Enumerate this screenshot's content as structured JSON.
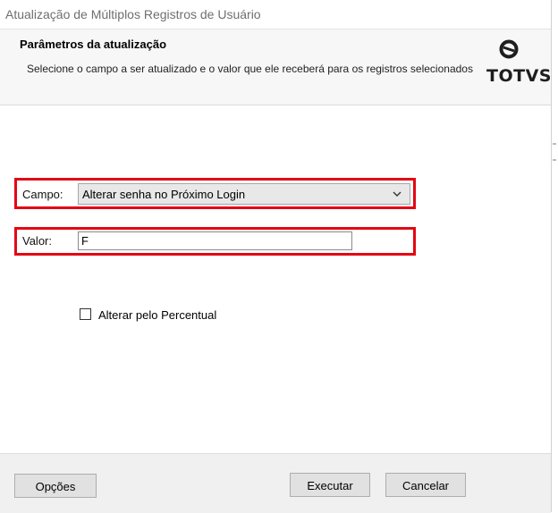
{
  "window": {
    "title": "Atualização de Múltiplos Registros de Usuário"
  },
  "header": {
    "title": "Parâmetros da atualização",
    "description": "Selecione o campo a ser atualizado e o valor que ele receberá para os registros selecionados",
    "logo_text": "TOTVS"
  },
  "form": {
    "campo_label": "Campo:",
    "campo_value": "Alterar senha no Próximo Login",
    "valor_label": "Valor:",
    "valor_value": "F",
    "checkbox_label": "Alterar pelo Percentual",
    "checkbox_checked": false
  },
  "footer": {
    "opcoes_label": "Opções",
    "executar_label": "Executar",
    "cancelar_label": "Cancelar"
  },
  "colors": {
    "highlight": "#e30613",
    "footer_bg": "#f0f0f0",
    "header_bg": "#f7f7f7"
  }
}
